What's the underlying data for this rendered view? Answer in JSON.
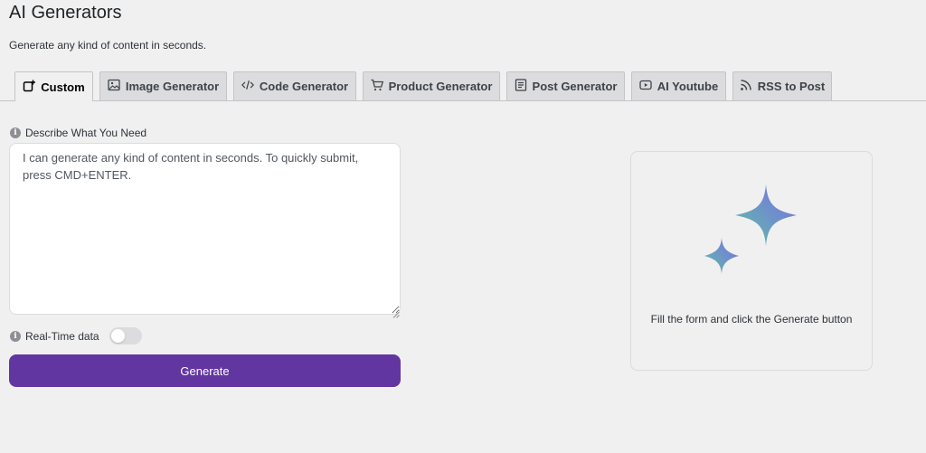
{
  "header": {
    "title": "AI Generators",
    "subtitle": "Generate any kind of content in seconds."
  },
  "tabs": [
    {
      "label": "Custom",
      "icon": "custom-icon",
      "active": true
    },
    {
      "label": "Image Generator",
      "icon": "image-icon",
      "active": false
    },
    {
      "label": "Code Generator",
      "icon": "code-icon",
      "active": false
    },
    {
      "label": "Product Generator",
      "icon": "cart-icon",
      "active": false
    },
    {
      "label": "Post Generator",
      "icon": "post-icon",
      "active": false
    },
    {
      "label": "AI Youtube",
      "icon": "youtube-icon",
      "active": false
    },
    {
      "label": "RSS to Post",
      "icon": "rss-icon",
      "active": false
    }
  ],
  "form": {
    "prompt_label": "Describe What You Need",
    "prompt_placeholder": "I can generate any kind of content in seconds. To quickly submit, press CMD+ENTER.",
    "prompt_value": "",
    "realtime_label": "Real-Time data",
    "realtime_enabled": false,
    "generate_label": "Generate"
  },
  "result": {
    "hint": "Fill the form and click the Generate button"
  },
  "colors": {
    "accent": "#6236a0",
    "background": "#f0f0f1",
    "sparkle_gradient": [
      "#5fc3a3",
      "#7a6ae8"
    ]
  }
}
